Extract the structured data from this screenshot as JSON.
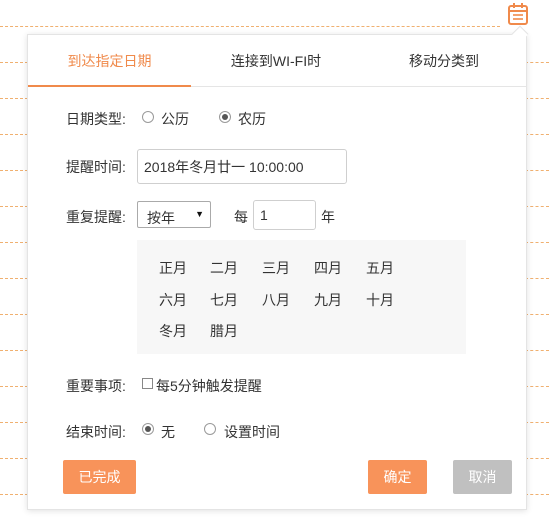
{
  "colors": {
    "accent": "#f08a4b",
    "button_primary": "#f8935a",
    "button_disabled": "#c0c0c0"
  },
  "header_icon": "calendar-icon",
  "tabs": [
    {
      "label": "到达指定日期",
      "active": true
    },
    {
      "label": "连接到WI-FI时",
      "active": false
    },
    {
      "label": "移动分类到",
      "active": false
    }
  ],
  "date_type": {
    "label": "日期类型:",
    "options": [
      {
        "label": "公历",
        "checked": false
      },
      {
        "label": "农历",
        "checked": true
      }
    ]
  },
  "reminder_time": {
    "label": "提醒时间:",
    "value": "2018年冬月廿一 10:00:00"
  },
  "repeat": {
    "label": "重复提醒:",
    "select_value": "按年",
    "every_label": "每",
    "count": "1",
    "unit_label": "年",
    "months": [
      "正月",
      "二月",
      "三月",
      "四月",
      "五月",
      "六月",
      "七月",
      "八月",
      "九月",
      "十月",
      "冬月",
      "腊月"
    ]
  },
  "important": {
    "label": "重要事项:",
    "checkbox_label": "每5分钟触发提醒",
    "checked": false
  },
  "end_time": {
    "label": "结束时间:",
    "options": [
      {
        "label": "无",
        "checked": true
      },
      {
        "label": "设置时间",
        "checked": false
      }
    ]
  },
  "buttons": {
    "done": "已完成",
    "confirm": "确定",
    "cancel": "取消"
  }
}
